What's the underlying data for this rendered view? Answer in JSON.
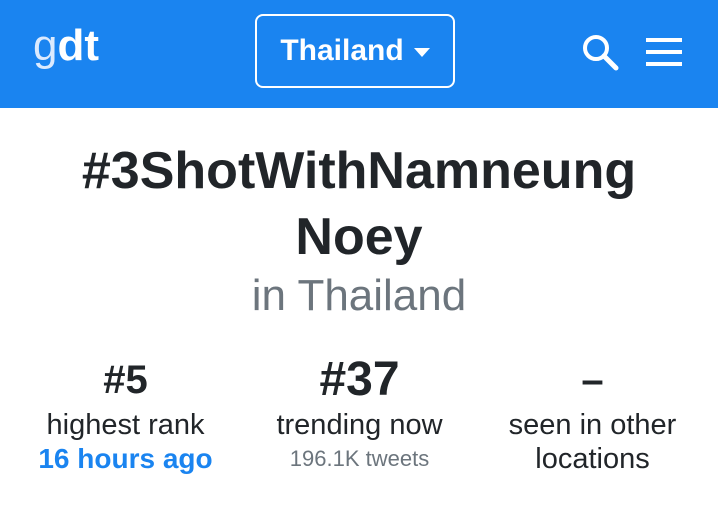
{
  "header": {
    "logo_g": "g",
    "logo_dt": "dt",
    "location": "Thailand",
    "icons": [
      "search-icon",
      "menu-icon"
    ],
    "brand_color": "#1a84f0"
  },
  "trend": {
    "title_line1": "#3ShotWithNamneung",
    "title_line2": "Noey",
    "subtitle": "in Thailand"
  },
  "stats": {
    "highest": {
      "value": "#5",
      "label": "highest rank",
      "time": "16 hours ago"
    },
    "trending": {
      "value": "#37",
      "label": "trending now",
      "tweets": "196.1K tweets"
    },
    "other": {
      "value": "–",
      "label_line1": "seen in other",
      "label_line2": "locations"
    }
  }
}
